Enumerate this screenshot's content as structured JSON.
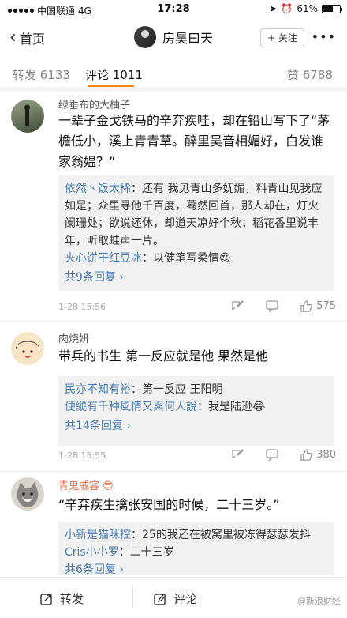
{
  "status_bar": {
    "carrier": "中国联通",
    "network": "4G",
    "time": "17:28",
    "battery": "61%",
    "battery_level": 0.61
  },
  "nav": {
    "back_label": "首页",
    "title": "房昊曰天",
    "follow_label": "+ 关注",
    "more_icon": "more-icon"
  },
  "tabs": {
    "repost": "转发 6133",
    "comment": "评论 1011",
    "like": "赞 6788",
    "accent": "#ff8200"
  },
  "comments": [
    {
      "user": "绿垂布的大柚子",
      "text": "一辈子金戈铁马的辛弃疾哇，却在铅山写下了“茅檐低小，溪上青青草。醉里吴音相媚好，白发谁家翁媪？”",
      "replies": [
        {
          "user": "依然丶饭太稀",
          "text": "还有 我见青山多妩媚，料青山见我应如是；众里寻他千百度，蓦然回首，那人却在，灯火阑珊处；欲说还休，却道天凉好个秋；稻花香里说丰年，听取蛙声一片。"
        },
        {
          "user": "夹心饼干红豆冰",
          "text": "以健笔写柔情😍"
        }
      ],
      "more_replies": "共9条回复 ›",
      "time": "1-28 15:56",
      "likes": "575"
    },
    {
      "user": "肉烧妍",
      "text": "带兵的书生 第一反应就是他 果然是他",
      "replies": [
        {
          "user": "民亦不知有裕",
          "text": "第一反应 王阳明"
        },
        {
          "user": "便縱有千种風情又與何人說",
          "text": "我是陆逊😂"
        }
      ],
      "more_replies": "共14条回复 ›",
      "time": "1-28 15:55",
      "likes": "380"
    },
    {
      "user": "青鬼戚容",
      "text": "“辛弃疾生擒张安国的时候，二十三岁。”",
      "replies": [
        {
          "user": "小新是猫咪控",
          "text": "25的我还在被窝里被冻得瑟瑟发抖"
        },
        {
          "user": "Cris小小罗",
          "text": "二十三岁"
        }
      ],
      "more_replies": "共6条回复 ›"
    }
  ],
  "bottom_bar": {
    "repost_label": "转发",
    "comment_label": "评论"
  },
  "watermark": "@新浪财经"
}
